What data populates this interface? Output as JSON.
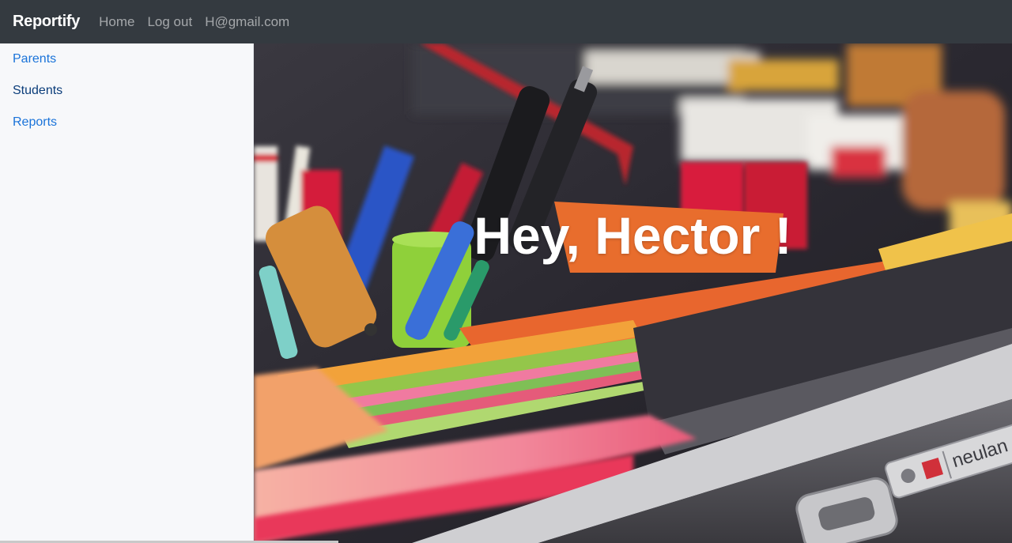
{
  "navbar": {
    "brand": "Reportify",
    "links": [
      "Home",
      "Log out",
      "H@gmail.com"
    ]
  },
  "sidebar": {
    "items": [
      {
        "label": "Parents"
      },
      {
        "label": "Students"
      },
      {
        "label": "Reports"
      }
    ]
  },
  "hero": {
    "greeting": "Hey, Hector !",
    "image_text": "neulan"
  },
  "colors": {
    "navbar_bg": "#343a40",
    "link_blue": "#1a73d9",
    "sidebar_bg": "#f7f8fa"
  }
}
